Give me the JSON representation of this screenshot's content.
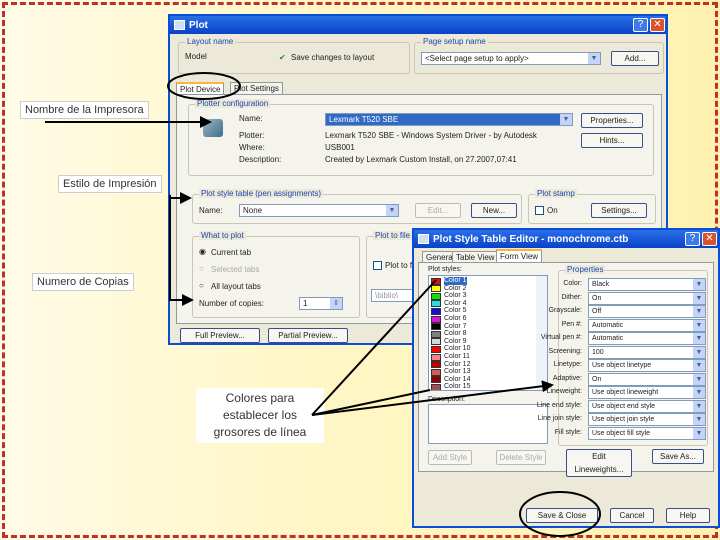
{
  "plot": {
    "title": "Plot",
    "layout_name_group": "Layout name",
    "layout_name": "Model",
    "save_changes": "Save changes to layout",
    "page_setup_group": "Page setup name",
    "page_setup_value": "<Select page setup to apply>",
    "add_button": "Add...",
    "tabs": [
      "Plot Device",
      "Plot Settings"
    ],
    "plotter_group": "Plotter configuration",
    "name_label": "Name:",
    "name_value": "Lexmark T520 SBE",
    "properties_button": "Properties...",
    "hints_button": "Hints...",
    "plotter_label": "Plotter:",
    "plotter_value": "Lexmark T520 SBE - Windows System Driver - by Autodesk",
    "where_label": "Where:",
    "where_value": "USB001",
    "description_label": "Description:",
    "description_value": "Created by Lexmark Custom Install, on 27.2007,07:41",
    "style_group": "Plot style table (pen assignments)",
    "style_name_label": "Name:",
    "style_name_value": "None",
    "edit_button": "Edit...",
    "new_button": "New...",
    "stamp_group": "Plot stamp",
    "stamp_on": "On",
    "settings_button": "Settings...",
    "what_group": "What to plot",
    "current_tab": "Current tab",
    "selected_tabs": "Selected tabs",
    "all_tabs": "All layout tabs",
    "copies_label": "Number of copies:",
    "copies_value": "1",
    "plot_to_file_group": "Plot to file",
    "plot_to_file": "Plot to file",
    "file_location": "\\biblio\\",
    "full_preview": "Full Preview...",
    "partial_preview": "Partial Preview..."
  },
  "editor": {
    "title": "Plot Style Table Editor - monochrome.ctb",
    "tabs": [
      "General",
      "Table View",
      "Form View"
    ],
    "styles_label": "Plot styles:",
    "styles": [
      {
        "name": "Color 1",
        "color": "#e01010"
      },
      {
        "name": "Color 2",
        "color": "#ffff00"
      },
      {
        "name": "Color 3",
        "color": "#10e010"
      },
      {
        "name": "Color 4",
        "color": "#20e0e0"
      },
      {
        "name": "Color 5",
        "color": "#1010d0"
      },
      {
        "name": "Color 6",
        "color": "#e010e0"
      },
      {
        "name": "Color 7",
        "color": "#000000"
      },
      {
        "name": "Color 8",
        "color": "#808080"
      },
      {
        "name": "Color 9",
        "color": "#d8d8d8"
      },
      {
        "name": "Color 10",
        "color": "#ff0000"
      },
      {
        "name": "Color 11",
        "color": "#ff8080"
      },
      {
        "name": "Color 12",
        "color": "#c00000"
      },
      {
        "name": "Color 13",
        "color": "#d06060"
      },
      {
        "name": "Color 14",
        "color": "#900000"
      },
      {
        "name": "Color 15",
        "color": "#a05050"
      }
    ],
    "description_label": "Description:",
    "properties_group": "Properties",
    "props": [
      {
        "label": "Color:",
        "value": "Black"
      },
      {
        "label": "Dither:",
        "value": "On"
      },
      {
        "label": "Grayscale:",
        "value": "Off"
      },
      {
        "label": "Pen #:",
        "value": "Automatic"
      },
      {
        "label": "Virtual pen #:",
        "value": "Automatic"
      },
      {
        "label": "Screening:",
        "value": "100"
      },
      {
        "label": "Linetype:",
        "value": "Use object linetype"
      },
      {
        "label": "Adaptive:",
        "value": "On"
      },
      {
        "label": "Lineweight:",
        "value": "Use object lineweight"
      },
      {
        "label": "Line end style:",
        "value": "Use object end style"
      },
      {
        "label": "Line join style:",
        "value": "Use object join style"
      },
      {
        "label": "Fill style:",
        "value": "Use object fill style"
      }
    ],
    "add_style": "Add Style",
    "delete_style": "Delete Style",
    "edit_lineweights": "Edit Lineweights...",
    "save_as": "Save As...",
    "save_close": "Save & Close",
    "cancel": "Cancel",
    "help": "Help"
  },
  "annotations": {
    "printer_name": "Nombre de la Impresora",
    "print_style": "Estilo de Impresión",
    "copies": "Numero de Copias",
    "colors": "Colores para establecer los grosores de línea"
  }
}
